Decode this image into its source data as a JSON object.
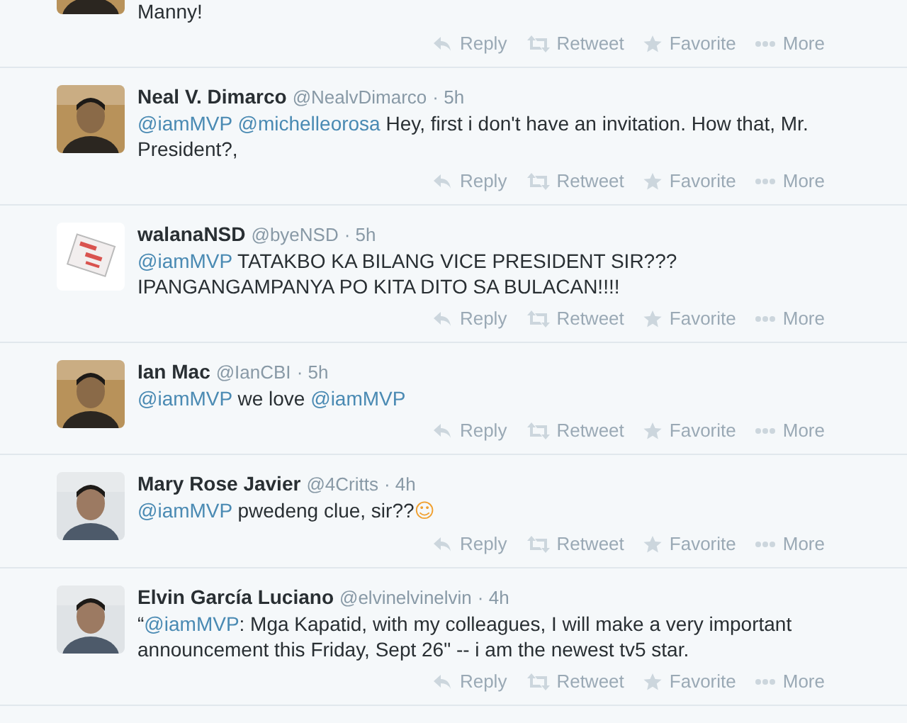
{
  "tweets": [
    {
      "kind": "partial",
      "segments": [
        {
          "kind": "text",
          "text": "Manny!"
        }
      ],
      "actions": [
        "Reply",
        "Retweet",
        "Favorite",
        "More"
      ]
    },
    {
      "kind": "full",
      "name": "Neal V. Dimarco",
      "handle": "@NealvDimarco",
      "time": "· 5h",
      "segments": [
        {
          "kind": "mention",
          "text": "@iamMVP"
        },
        {
          "kind": "mention",
          "text": "@michelleorosa"
        },
        {
          "kind": "text",
          "text": " Hey, first i don't have an invitation. How that, Mr. President?,"
        }
      ],
      "actions": [
        "Reply",
        "Retweet",
        "Favorite",
        "More"
      ]
    },
    {
      "kind": "full",
      "name": "walanaNSD",
      "handle": "@byeNSD",
      "time": "· 5h",
      "segments": [
        {
          "kind": "mention",
          "text": "@iamMVP"
        },
        {
          "kind": "text",
          "text": " TATAKBO KA BILANG VICE PRESIDENT SIR??? IPANGANGAMPANYA PO KITA DITO SA BULACAN!!!!"
        }
      ],
      "actions": [
        "Reply",
        "Retweet",
        "Favorite",
        "More"
      ]
    },
    {
      "kind": "full",
      "name": "Ian Mac",
      "handle": "@IanCBI",
      "time": "· 5h",
      "segments": [
        {
          "kind": "mention",
          "text": "@iamMVP"
        },
        {
          "kind": "text",
          "text": " we love "
        },
        {
          "kind": "mention",
          "text": "@iamMVP"
        }
      ],
      "actions": [
        "Reply",
        "Retweet",
        "Favorite",
        "More"
      ]
    },
    {
      "kind": "full",
      "name": "Mary Rose Javier",
      "handle": "@4Critts",
      "time": "· 4h",
      "segments": [
        {
          "kind": "mention",
          "text": "@iamMVP"
        },
        {
          "kind": "text",
          "text": " pwedeng clue, sir??"
        },
        {
          "kind": "emoji",
          "text": "☺"
        }
      ],
      "actions": [
        "Reply",
        "Retweet",
        "Favorite",
        "More"
      ]
    },
    {
      "kind": "full",
      "name": "Elvin García Luciano",
      "handle": "@elvinelvinelvin",
      "time": "· 4h",
      "segments": [
        {
          "kind": "text",
          "text": "“"
        },
        {
          "kind": "mention",
          "text": "@iamMVP"
        },
        {
          "kind": "text",
          "text": ": Mga Kapatid, with my colleagues, I will make a very important announcement this Friday, Sept 26\" -- i am the newest tv5 star."
        }
      ],
      "actions": [
        "Reply",
        "Retweet",
        "Favorite",
        "More"
      ]
    }
  ]
}
